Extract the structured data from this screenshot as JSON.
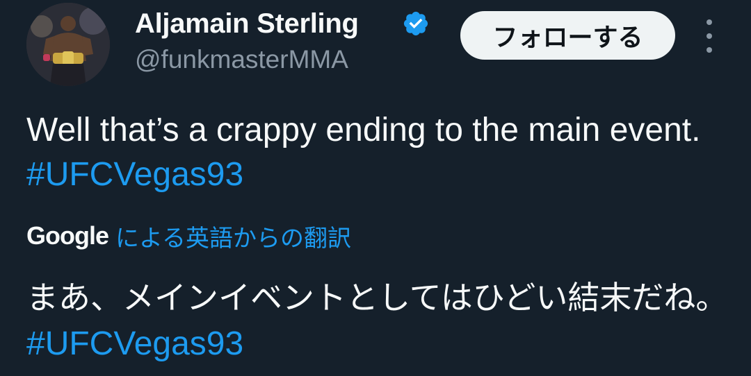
{
  "author": {
    "display_name": "Aljamain Sterling",
    "handle": "@funkmasterMMA",
    "verified": true,
    "avatar_icon": "profile-photo-fighter-with-belt"
  },
  "header": {
    "follow_label": "フォローする",
    "more_icon": "more-vertical-icon"
  },
  "tweet": {
    "text": "Well that’s a crappy ending to the main event. ",
    "hashtag": "#UFCVegas93"
  },
  "translation": {
    "provider": "Google",
    "link_label": "による英語からの翻訳",
    "text": "まあ、メインイベントとしてはひどい結末だね。 ",
    "hashtag": "#UFCVegas93"
  },
  "colors": {
    "background": "#15202b",
    "text": "#f7f9f9",
    "secondary_text": "#8b98a5",
    "accent": "#1d9bf0",
    "verified_badge": "#1d9bf0",
    "follow_button_bg": "#eff3f4"
  }
}
